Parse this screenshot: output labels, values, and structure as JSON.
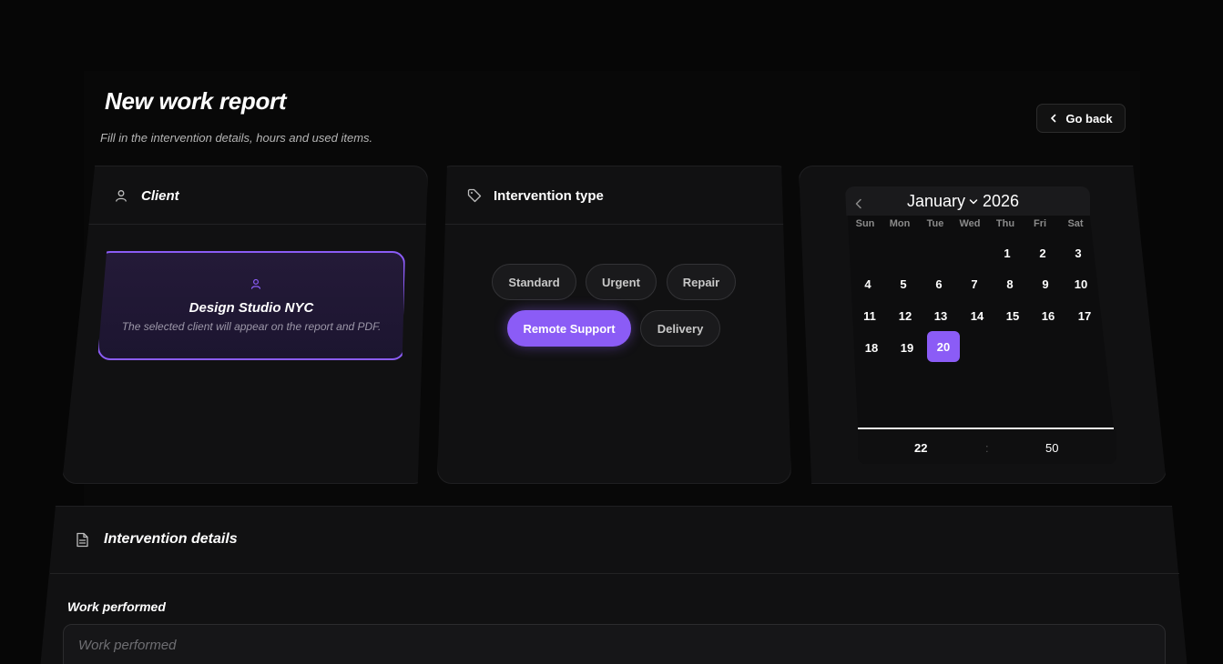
{
  "header": {
    "title": "New work report",
    "subtitle": "Fill in the intervention details, hours and used items.",
    "go_back_label": "Go back"
  },
  "client_card": {
    "title": "Client",
    "selected_name": "Design Studio NYC",
    "hint": "The selected client will appear on the report and PDF."
  },
  "type_card": {
    "title": "Intervention type",
    "options": [
      "Standard",
      "Urgent",
      "Repair",
      "Remote Support",
      "Delivery"
    ],
    "selected": "Remote Support"
  },
  "calendar": {
    "month": "January",
    "year": "2026",
    "weekdays": [
      "Sun",
      "Mon",
      "Tue",
      "Wed",
      "Thu",
      "Fri",
      "Sat"
    ],
    "days": [
      "1",
      "2",
      "3",
      "4",
      "5",
      "6",
      "7",
      "8",
      "9",
      "10",
      "11",
      "12",
      "13",
      "14",
      "15",
      "16",
      "17",
      "18",
      "19",
      "20"
    ],
    "selected_day": "20",
    "time": {
      "hour": "22",
      "separator": ":",
      "minute": "50"
    }
  },
  "details_card": {
    "title": "Intervention details",
    "work_label": "Work performed",
    "work_placeholder": "Work performed",
    "work_value": ""
  },
  "colors": {
    "accent": "#8b5cf6",
    "background": "#060606",
    "card": "#111112"
  },
  "icons": {
    "go_back": "chevron-left-icon",
    "client": "user-icon",
    "type": "tag-icon",
    "details": "document-icon"
  }
}
